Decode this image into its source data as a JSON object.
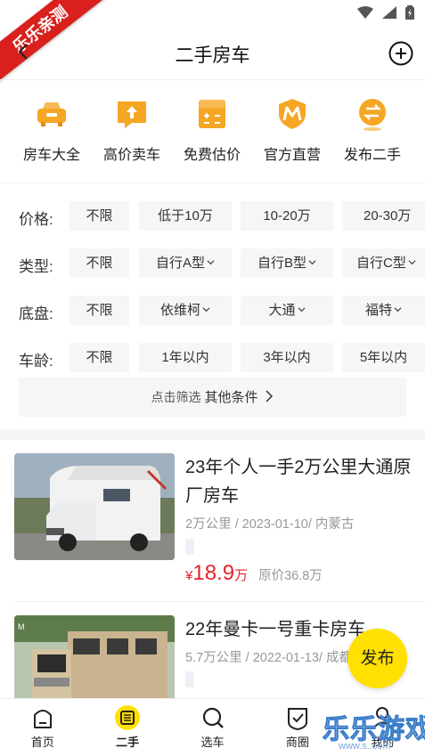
{
  "ribbon": {
    "text": "乐乐亲测"
  },
  "header": {
    "title": "二手房车"
  },
  "quick_actions": [
    {
      "label": "房车大全",
      "icon": "car-icon"
    },
    {
      "label": "高价卖车",
      "icon": "sell-icon"
    },
    {
      "label": "免费估价",
      "icon": "calculator-icon"
    },
    {
      "label": "官方直营",
      "icon": "shield-icon"
    },
    {
      "label": "发布二手",
      "icon": "exchange-icon"
    }
  ],
  "filters": [
    {
      "label": "价格:",
      "options": [
        "不限",
        "低于10万",
        "10-20万",
        "20-30万"
      ]
    },
    {
      "label": "类型:",
      "options": [
        "不限",
        "自行A型",
        "自行B型",
        "自行C型"
      ]
    },
    {
      "label": "底盘:",
      "options": [
        "不限",
        "依维柯",
        "大通",
        "福特"
      ]
    },
    {
      "label": "车龄:",
      "options": [
        "不限",
        "1年以内",
        "3年以内",
        "5年以内"
      ]
    }
  ],
  "more_filter": {
    "prefix": "点击筛选",
    "label": "其他条件"
  },
  "listings": [
    {
      "title": "23年个人一手2万公里大通原厂房车",
      "meta": "2万公里 / 2023-01-10/ 内蒙古",
      "currency": "¥",
      "price": "18.9",
      "unit": "万",
      "original": "原价36.8万"
    },
    {
      "title": "22年曼卡一号重卡房车",
      "meta": "5.7万公里 / 2022-01-13/ 成都"
    }
  ],
  "fab": {
    "label": "发布"
  },
  "tabs": [
    {
      "label": "首页",
      "icon": "home-icon"
    },
    {
      "label": "二手",
      "icon": "secondhand-icon",
      "active": true
    },
    {
      "label": "选车",
      "icon": "search-icon"
    },
    {
      "label": "商圈",
      "icon": "check-icon"
    },
    {
      "label": "我的",
      "icon": "user-icon"
    }
  ],
  "watermark": {
    "text": "乐乐游戏",
    "sub": "www.s..com"
  },
  "colors": {
    "accent": "#ffe000",
    "quick_icon": "#f5a623",
    "price": "#e5222a",
    "ribbon": "#d9201c"
  }
}
